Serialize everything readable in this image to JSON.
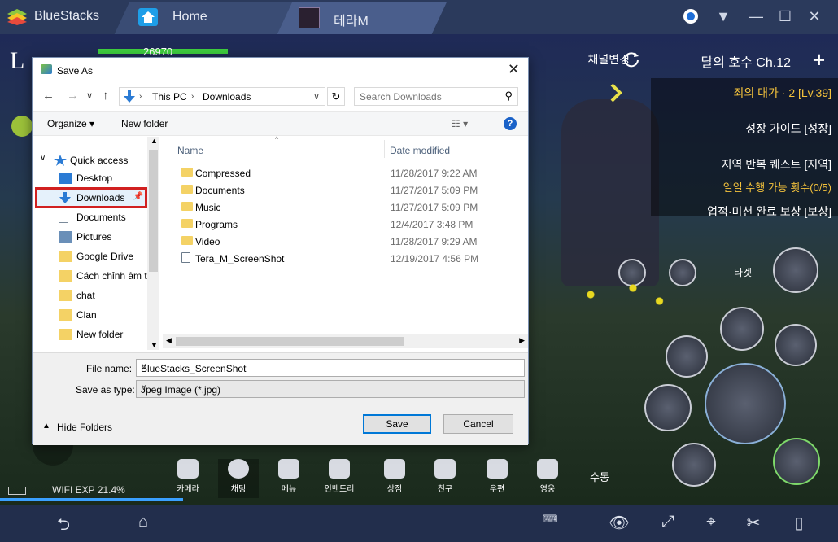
{
  "window": {
    "app_name": "BlueStacks",
    "tabs": [
      {
        "label": "Home"
      },
      {
        "label": "테라M"
      }
    ]
  },
  "game": {
    "hp_value": "26970",
    "right_panel": {
      "channel_change": "채널변경",
      "zone": "달의 호수 Ch.12",
      "quests": [
        {
          "label": "죄의 대가 · 2 [Lv.39]",
          "gold": true
        },
        {
          "label": "성장 가이드 [성장]",
          "gold": false
        },
        {
          "label": "지역 반복 퀘스트 [지역]",
          "gold": false
        },
        {
          "label": "일일 수행 가능 횟수(0/5)",
          "gold": true
        },
        {
          "label": "업적·미션 완료 보상 [보상]",
          "gold": false
        }
      ],
      "target_label": "타겟"
    },
    "bottom_menu": [
      {
        "label": "카메라"
      },
      {
        "label": "채팅"
      },
      {
        "label": "메뉴"
      },
      {
        "label": "인벤토리"
      },
      {
        "label": "상점"
      },
      {
        "label": "친구"
      },
      {
        "label": "우편"
      },
      {
        "label": "영웅"
      },
      {
        "label": "수동"
      }
    ],
    "status": "WIFI EXP 21.4%"
  },
  "dialog": {
    "title": "Save As",
    "address": {
      "crumbs": [
        "This PC",
        "Downloads"
      ]
    },
    "search_placeholder": "Search Downloads",
    "commands": {
      "organize": "Organize",
      "new_folder": "New folder"
    },
    "nav": [
      {
        "label": "Quick access",
        "icon": "star-icon",
        "pinned": false
      },
      {
        "label": "Desktop",
        "icon": "desktop-icon",
        "pinned": true
      },
      {
        "label": "Downloads",
        "icon": "download-arrow-icon",
        "pinned": true,
        "selected": true
      },
      {
        "label": "Documents",
        "icon": "documents-icon",
        "pinned": true
      },
      {
        "label": "Pictures",
        "icon": "pictures-icon",
        "pinned": true
      },
      {
        "label": "Google Drive",
        "icon": "google-drive-icon",
        "pinned": true
      },
      {
        "label": "Cách chỉnh âm t",
        "icon": "folder-icon",
        "pinned": false
      },
      {
        "label": "chat",
        "icon": "folder-icon",
        "pinned": false
      },
      {
        "label": "Clan",
        "icon": "folder-icon",
        "pinned": false
      },
      {
        "label": "New folder",
        "icon": "folder-icon",
        "pinned": false
      }
    ],
    "columns": {
      "name": "Name",
      "date": "Date modified"
    },
    "files": [
      {
        "name": "Compressed",
        "date": "11/28/2017 9:22 AM",
        "type": "folder"
      },
      {
        "name": "Documents",
        "date": "11/27/2017 5:09 PM",
        "type": "folder"
      },
      {
        "name": "Music",
        "date": "11/27/2017 5:09 PM",
        "type": "folder"
      },
      {
        "name": "Programs",
        "date": "12/4/2017 3:48 PM",
        "type": "folder"
      },
      {
        "name": "Video",
        "date": "11/28/2017 9:29 AM",
        "type": "folder"
      },
      {
        "name": "Tera_M_ScreenShot",
        "date": "12/19/2017 4:56 PM",
        "type": "file"
      }
    ],
    "fields": {
      "filename_label": "File name:",
      "filename_value": "BlueStacks_ScreenShot",
      "type_label": "Save as type:",
      "type_value": "Jpeg Image (*.jpg)"
    },
    "hide_folders": "Hide Folders",
    "save": "Save",
    "cancel": "Cancel"
  },
  "colors": {
    "highlight": "#d12020",
    "accent": "#0078d7"
  }
}
